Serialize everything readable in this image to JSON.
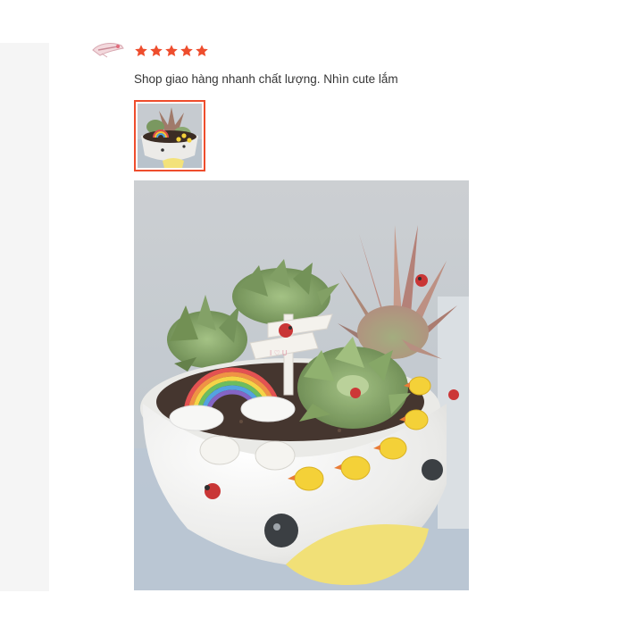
{
  "review": {
    "rating": 5,
    "rating_max": 5,
    "comment": "Shop giao hàng nhanh chất lượng. Nhìn cute lắm"
  },
  "media": {
    "thumbnails": [
      {
        "name": "review-photo-thumbnail",
        "selected": true
      }
    ]
  },
  "colors": {
    "accent": "#ee4d2d",
    "star": "#ee4d2d",
    "gutter": "#f5f5f5",
    "text": "#333333"
  },
  "icons": {
    "rating_star": "star-icon",
    "reviewer": "avatar"
  }
}
